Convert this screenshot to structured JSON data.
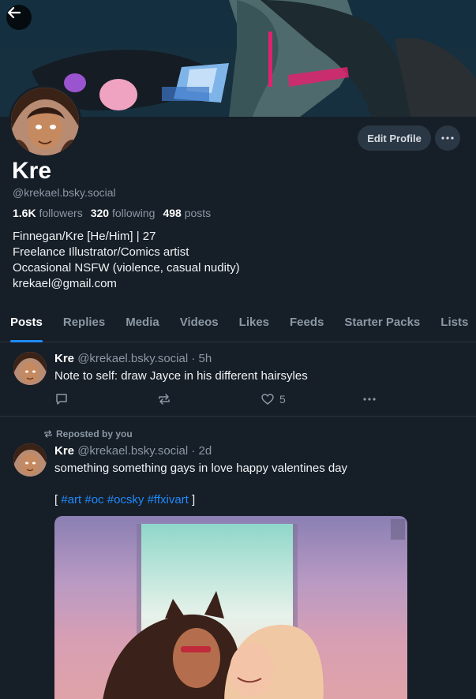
{
  "profile": {
    "display_name": "Kre",
    "handle": "@krekael.bsky.social",
    "followers_count": "1.6K",
    "followers_label": "followers",
    "following_count": "320",
    "following_label": "following",
    "posts_count": "498",
    "posts_label": "posts",
    "bio": [
      "Finnegan/Kre [He/Him] | 27",
      "Freelance Illustrator/Comics artist",
      "Occasional NSFW (violence, casual nudity)",
      "krekael@gmail.com"
    ],
    "edit_profile_label": "Edit Profile",
    "more_label": "···"
  },
  "tabs": [
    {
      "label": "Posts",
      "active": true
    },
    {
      "label": "Replies"
    },
    {
      "label": "Media"
    },
    {
      "label": "Videos"
    },
    {
      "label": "Likes"
    },
    {
      "label": "Feeds"
    },
    {
      "label": "Starter Packs"
    },
    {
      "label": "Lists"
    }
  ],
  "posts": [
    {
      "name": "Kre",
      "handle": "@krekael.bsky.social",
      "time": "· 5h",
      "text": "Note to self: draw Jayce in his different hairsyles",
      "like_count": "5"
    },
    {
      "repost_label": "Reposted by you",
      "name": "Kre",
      "handle": "@krekael.bsky.social",
      "time": "· 2d",
      "text": "something something gays in love happy valentines day",
      "tags_open": "[ ",
      "tags": [
        "#art",
        "#oc",
        "#ocsky",
        "#ffxivart"
      ],
      "tags_close": " ]"
    }
  ],
  "icons": {
    "back": "arrow-left-icon",
    "reply": "speech-bubble-icon",
    "repost": "repost-icon",
    "like": "heart-icon",
    "more": "ellipsis-icon"
  },
  "colors": {
    "background": "#161e27",
    "accent": "#208bfe",
    "muted": "#8b98a5",
    "button_bg": "#2a3745"
  }
}
